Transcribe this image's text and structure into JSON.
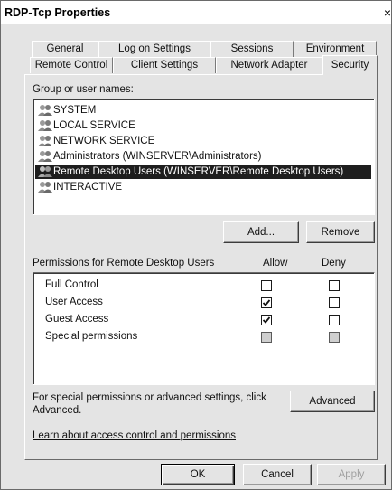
{
  "window": {
    "title": "RDP-Tcp Properties",
    "close_glyph": "×"
  },
  "tabs_row_back": [
    {
      "label": "General"
    },
    {
      "label": "Log on Settings"
    },
    {
      "label": "Sessions"
    },
    {
      "label": "Environment"
    }
  ],
  "tabs_row_front": [
    {
      "label": "Remote Control"
    },
    {
      "label": "Client Settings"
    },
    {
      "label": "Network Adapter"
    },
    {
      "label": "Security",
      "active": true
    }
  ],
  "groups": {
    "label": "Group or user names:",
    "items": [
      {
        "name": "SYSTEM",
        "icon": "users-icon"
      },
      {
        "name": "LOCAL SERVICE",
        "icon": "users-icon"
      },
      {
        "name": "NETWORK SERVICE",
        "icon": "users-icon"
      },
      {
        "name": "Administrators (WINSERVER\\Administrators)",
        "icon": "users-icon"
      },
      {
        "name": "Remote Desktop Users (WINSERVER\\Remote Desktop Users)",
        "icon": "users-icon",
        "selected": true
      },
      {
        "name": "INTERACTIVE",
        "icon": "users-icon"
      }
    ]
  },
  "buttons": {
    "add": "Add...",
    "remove": "Remove",
    "advanced": "Advanced",
    "ok": "OK",
    "cancel": "Cancel",
    "apply": "Apply"
  },
  "permissions": {
    "title": "Permissions for Remote Desktop Users",
    "allow_header": "Allow",
    "deny_header": "Deny",
    "rows": [
      {
        "label": "Full Control",
        "allow": "unchecked",
        "deny": "unchecked"
      },
      {
        "label": "User Access",
        "allow": "checked",
        "deny": "unchecked"
      },
      {
        "label": "Guest Access",
        "allow": "checked",
        "deny": "unchecked"
      },
      {
        "label": "Special permissions",
        "allow": "disabled",
        "deny": "disabled"
      }
    ]
  },
  "advanced_text_line1": "For special permissions or advanced settings, click",
  "advanced_text_line2": "Advanced.",
  "learn_link": "Learn about access control and permissions"
}
